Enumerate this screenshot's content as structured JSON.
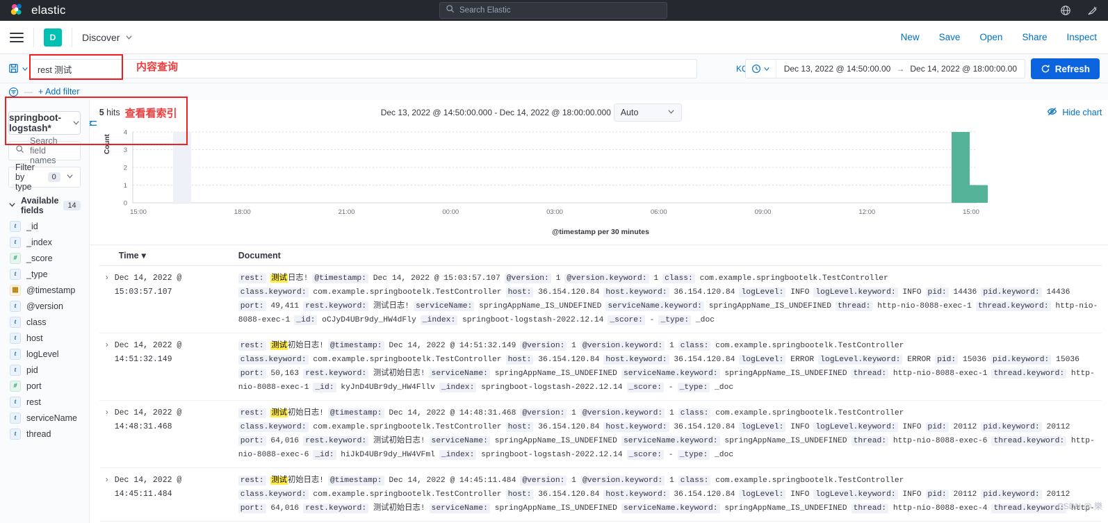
{
  "topbar": {
    "brand": "elastic",
    "search_placeholder": "Search Elastic",
    "icons": [
      "globe-icon",
      "announcement-icon"
    ]
  },
  "nav": {
    "app_badge": "D",
    "app_title": "Discover",
    "links": [
      "New",
      "Save",
      "Open",
      "Share",
      "Inspect"
    ]
  },
  "query": {
    "value": "rest 测试",
    "language": "KQL",
    "date_from": "Dec 13, 2022 @ 14:50:00.00",
    "date_arrow": "→",
    "date_to": "Dec 14, 2022 @ 18:00:00.00",
    "refresh_label": "Refresh",
    "add_filter": "+ Add filter"
  },
  "annotations": {
    "query_note": "内容查询",
    "index_note": "查看看索引"
  },
  "sidebar": {
    "index_pattern": "springboot-logstash*",
    "field_search_placeholder": "Search field names",
    "filter_by_type_label": "Filter by type",
    "filter_by_type_count": "0",
    "available_fields_label": "Available fields",
    "available_fields_count": "14",
    "fields": [
      {
        "name": "_id",
        "type": "string"
      },
      {
        "name": "_index",
        "type": "string"
      },
      {
        "name": "_score",
        "type": "number"
      },
      {
        "name": "_type",
        "type": "string"
      },
      {
        "name": "@timestamp",
        "type": "date"
      },
      {
        "name": "@version",
        "type": "string"
      },
      {
        "name": "class",
        "type": "string"
      },
      {
        "name": "host",
        "type": "string"
      },
      {
        "name": "logLevel",
        "type": "string"
      },
      {
        "name": "pid",
        "type": "string"
      },
      {
        "name": "port",
        "type": "number"
      },
      {
        "name": "rest",
        "type": "string"
      },
      {
        "name": "serviceName",
        "type": "string"
      },
      {
        "name": "thread",
        "type": "string"
      }
    ]
  },
  "chart_panel": {
    "hits_number": "5",
    "hits_label": "hits",
    "range_text": "Dec 13, 2022 @ 14:50:00.000 - Dec 14, 2022 @ 18:00:00.000",
    "interval": "Auto",
    "hide_chart_label": "Hide chart"
  },
  "chart_data": {
    "type": "bar",
    "title": "",
    "xlabel": "@timestamp per 30 minutes",
    "ylabel": "Count",
    "ylim": [
      0,
      4
    ],
    "yticks": [
      0,
      1,
      2,
      3,
      4
    ],
    "xticks": [
      "15:00",
      "18:00",
      "21:00",
      "00:00",
      "03:00",
      "06:00",
      "09:00",
      "12:00",
      "15:00"
    ],
    "grid": true,
    "legend": "none",
    "bar_color": "#54b399",
    "categories": [
      "Dec 14 14:30",
      "Dec 14 15:00"
    ],
    "values": [
      4,
      1
    ]
  },
  "doc_table": {
    "col_time": "Time",
    "col_document": "Document",
    "sort_indicator": "▾",
    "rows": [
      {
        "time": "Dec 14, 2022 @ 15:03:57.107",
        "lines": [
          [
            {
              "k": "rest:",
              "v": "测试日志!",
              "hl": "测试"
            },
            {
              "k": "@timestamp:",
              "v": "Dec 14, 2022 @ 15:03:57.107"
            },
            {
              "k": "@version:",
              "v": "1"
            },
            {
              "k": "@version.keyword:",
              "v": "1"
            },
            {
              "k": "class:",
              "v": "com.example.springbootelk.TestController"
            }
          ],
          [
            {
              "k": "class.keyword:",
              "v": "com.example.springbootelk.TestController"
            },
            {
              "k": "host:",
              "v": "36.154.120.84"
            },
            {
              "k": "host.keyword:",
              "v": "36.154.120.84"
            },
            {
              "k": "logLevel:",
              "v": "INFO"
            },
            {
              "k": "logLevel.keyword:",
              "v": "INFO"
            },
            {
              "k": "pid:",
              "v": "14436"
            },
            {
              "k": "pid.keyword:",
              "v": "14436"
            }
          ],
          [
            {
              "k": "port:",
              "v": "49,411"
            },
            {
              "k": "rest.keyword:",
              "v": "测试日志!"
            },
            {
              "k": "serviceName:",
              "v": "springAppName_IS_UNDEFINED"
            },
            {
              "k": "serviceName.keyword:",
              "v": "springAppName_IS_UNDEFINED"
            },
            {
              "k": "thread:",
              "v": "http-nio-8088-exec-1"
            },
            {
              "k": "thread.keyword:",
              "v": "http-nio-"
            }
          ],
          [
            {
              "k": "",
              "v": "8088-exec-1"
            },
            {
              "k": "_id:",
              "v": "oCJyD4UBr9dy_HW4dFly"
            },
            {
              "k": "_index:",
              "v": "springboot-logstash-2022.12.14"
            },
            {
              "k": "_score:",
              "v": "-"
            },
            {
              "k": "_type:",
              "v": "_doc"
            }
          ]
        ]
      },
      {
        "time": "Dec 14, 2022 @ 14:51:32.149",
        "lines": [
          [
            {
              "k": "rest:",
              "v": "测试初始日志!",
              "hl": "测试"
            },
            {
              "k": "@timestamp:",
              "v": "Dec 14, 2022 @ 14:51:32.149"
            },
            {
              "k": "@version:",
              "v": "1"
            },
            {
              "k": "@version.keyword:",
              "v": "1"
            },
            {
              "k": "class:",
              "v": "com.example.springbootelk.TestController"
            }
          ],
          [
            {
              "k": "class.keyword:",
              "v": "com.example.springbootelk.TestController"
            },
            {
              "k": "host:",
              "v": "36.154.120.84"
            },
            {
              "k": "host.keyword:",
              "v": "36.154.120.84"
            },
            {
              "k": "logLevel:",
              "v": "ERROR"
            },
            {
              "k": "logLevel.keyword:",
              "v": "ERROR"
            },
            {
              "k": "pid:",
              "v": "15036"
            },
            {
              "k": "pid.keyword:",
              "v": "15036"
            }
          ],
          [
            {
              "k": "port:",
              "v": "50,163"
            },
            {
              "k": "rest.keyword:",
              "v": "测试初始日志!"
            },
            {
              "k": "serviceName:",
              "v": "springAppName_IS_UNDEFINED"
            },
            {
              "k": "serviceName.keyword:",
              "v": "springAppName_IS_UNDEFINED"
            },
            {
              "k": "thread:",
              "v": "http-nio-8088-exec-1"
            },
            {
              "k": "thread.keyword:",
              "v": "http-"
            }
          ],
          [
            {
              "k": "",
              "v": "nio-8088-exec-1"
            },
            {
              "k": "_id:",
              "v": "kyJnD4UBr9dy_HW4Fllv"
            },
            {
              "k": "_index:",
              "v": "springboot-logstash-2022.12.14"
            },
            {
              "k": "_score:",
              "v": "-"
            },
            {
              "k": "_type:",
              "v": "_doc"
            }
          ]
        ]
      },
      {
        "time": "Dec 14, 2022 @ 14:48:31.468",
        "lines": [
          [
            {
              "k": "rest:",
              "v": "测试初始日志!",
              "hl": "测试"
            },
            {
              "k": "@timestamp:",
              "v": "Dec 14, 2022 @ 14:48:31.468"
            },
            {
              "k": "@version:",
              "v": "1"
            },
            {
              "k": "@version.keyword:",
              "v": "1"
            },
            {
              "k": "class:",
              "v": "com.example.springbootelk.TestController"
            }
          ],
          [
            {
              "k": "class.keyword:",
              "v": "com.example.springbootelk.TestController"
            },
            {
              "k": "host:",
              "v": "36.154.120.84"
            },
            {
              "k": "host.keyword:",
              "v": "36.154.120.84"
            },
            {
              "k": "logLevel:",
              "v": "INFO"
            },
            {
              "k": "logLevel.keyword:",
              "v": "INFO"
            },
            {
              "k": "pid:",
              "v": "20112"
            },
            {
              "k": "pid.keyword:",
              "v": "20112"
            }
          ],
          [
            {
              "k": "port:",
              "v": "64,016"
            },
            {
              "k": "rest.keyword:",
              "v": "测试初始日志!"
            },
            {
              "k": "serviceName:",
              "v": "springAppName_IS_UNDEFINED"
            },
            {
              "k": "serviceName.keyword:",
              "v": "springAppName_IS_UNDEFINED"
            },
            {
              "k": "thread:",
              "v": "http-nio-8088-exec-6"
            },
            {
              "k": "thread.keyword:",
              "v": "http-"
            }
          ],
          [
            {
              "k": "",
              "v": "nio-8088-exec-6"
            },
            {
              "k": "_id:",
              "v": "hiJkD4UBr9dy_HW4VFml"
            },
            {
              "k": "_index:",
              "v": "springboot-logstash-2022.12.14"
            },
            {
              "k": "_score:",
              "v": "-"
            },
            {
              "k": "_type:",
              "v": "_doc"
            }
          ]
        ]
      },
      {
        "time": "Dec 14, 2022 @ 14:45:11.484",
        "lines": [
          [
            {
              "k": "rest:",
              "v": "测试初始日志!",
              "hl": "测试"
            },
            {
              "k": "@timestamp:",
              "v": "Dec 14, 2022 @ 14:45:11.484"
            },
            {
              "k": "@version:",
              "v": "1"
            },
            {
              "k": "@version.keyword:",
              "v": "1"
            },
            {
              "k": "class:",
              "v": "com.example.springbootelk.TestController"
            }
          ],
          [
            {
              "k": "class.keyword:",
              "v": "com.example.springbootelk.TestController"
            },
            {
              "k": "host:",
              "v": "36.154.120.84"
            },
            {
              "k": "host.keyword:",
              "v": "36.154.120.84"
            },
            {
              "k": "logLevel:",
              "v": "INFO"
            },
            {
              "k": "logLevel.keyword:",
              "v": "INFO"
            },
            {
              "k": "pid:",
              "v": "20112"
            },
            {
              "k": "pid.keyword:",
              "v": "20112"
            }
          ],
          [
            {
              "k": "port:",
              "v": "64,016"
            },
            {
              "k": "rest.keyword:",
              "v": "测试初始日志!"
            },
            {
              "k": "serviceName:",
              "v": "springAppName_IS_UNDEFINED"
            },
            {
              "k": "serviceName.keyword:",
              "v": "springAppName_IS_UNDEFINED"
            },
            {
              "k": "thread:",
              "v": "http-nio-8088-exec-4"
            },
            {
              "k": "thread.keyword:",
              "v": "http-"
            }
          ]
        ]
      }
    ]
  },
  "watermark": "CSDN @ 樂"
}
